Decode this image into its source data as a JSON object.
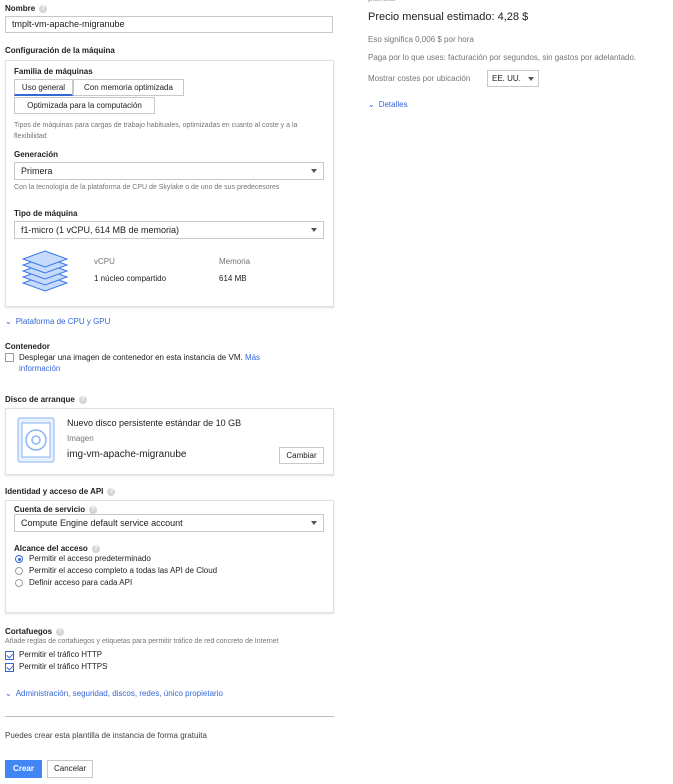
{
  "name": {
    "label": "Nombre",
    "value": "tmplt-vm-apache-migranube"
  },
  "machine": {
    "section_title": "Configuración de la máquina",
    "family_label": "Familia de máquinas",
    "tabs": [
      "Uso general",
      "Con memoria optimizada",
      "Optimizada para la computación"
    ],
    "family_desc": "Tipos de máquinas para cargas de trabajo habituales, optimizadas en cuanto al coste y a la flexibilidad",
    "generation_label": "Generación",
    "generation_value": "Primera",
    "generation_desc": "Con la tecnología de la plataforma de CPU de Skylake o de uno de sus predecesores",
    "type_label": "Tipo de máquina",
    "type_value": "f1-micro (1 vCPU, 614 MB de memoria)",
    "vcpu_header": "vCPU",
    "vcpu_value": "1 núcleo compartido",
    "memory_header": "Memoria",
    "memory_value": "614 MB"
  },
  "cpu_platform_link": "Plataforma de CPU y GPU",
  "container": {
    "label": "Contenedor",
    "text": "Desplegar una imagen de contenedor en esta instancia de VM.",
    "more_1": "Más",
    "more_2": "información"
  },
  "boot_disk": {
    "label": "Disco de arranque",
    "title": "Nuevo disco persistente estándar de 10 GB",
    "image_label": "Imagen",
    "image_value": "img-vm-apache-migranube",
    "change_button": "Cambiar"
  },
  "identity": {
    "label": "Identidad y acceso de API",
    "service_account_label": "Cuenta de servicio",
    "service_account_value": "Compute Engine default service account",
    "scope_label": "Alcance del acceso",
    "options": [
      "Permitir el acceso predeterminado",
      "Permitir el acceso completo a todas las API de Cloud",
      "Definir acceso para cada API"
    ],
    "selected_index": 0
  },
  "firewall": {
    "label": "Cortafuegos",
    "desc": "Añade reglas de cortafuegos y etiquetas para permitir tráfico de red concreto de Internet",
    "http": "Permitir el tráfico HTTP",
    "https": "Permitir el tráfico HTTPS",
    "http_checked": true,
    "https_checked": true
  },
  "advanced_link": "Administración, seguridad, discos, redes, único propietario",
  "free_note": "Puedes crear esta plantilla de instancia de forma gratuita",
  "actions": {
    "create": "Crear",
    "cancel": "Cancelar"
  },
  "pricing": {
    "cut_text": "plantilla",
    "title": "Precio mensual estimado: 4,28 $",
    "hourly": "Eso significa 0,006 $ por hora",
    "billing": "Paga por lo que uses: facturación por segundos, sin gastos por adelantado.",
    "location_label": "Mostrar costes por ubicación",
    "location_value": "EE. UU.",
    "details_link": "Detalles"
  },
  "colors": {
    "accent": "#3367d6",
    "primary_button": "#4285f4"
  }
}
